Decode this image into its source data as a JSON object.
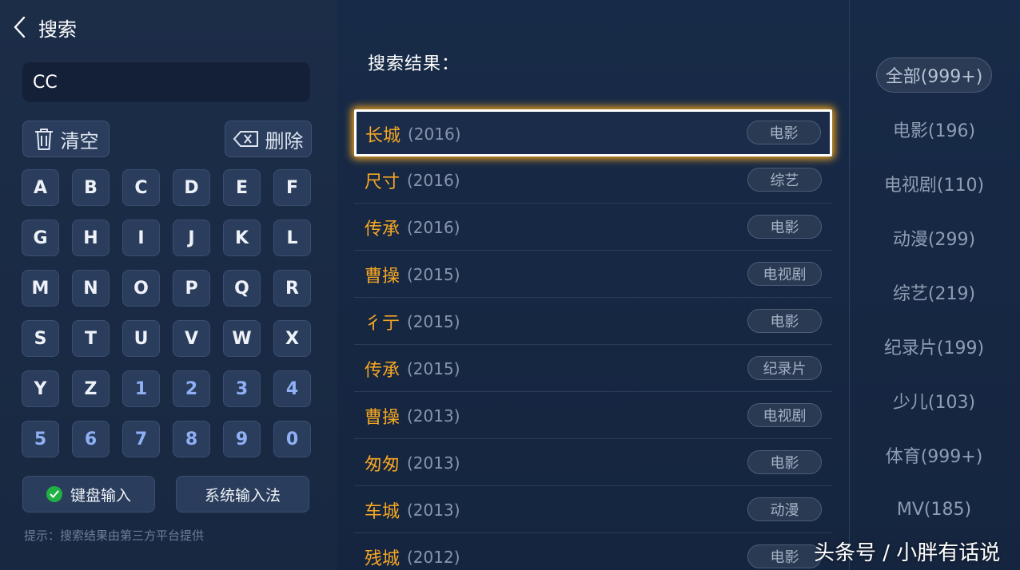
{
  "header": {
    "title": "搜索"
  },
  "search": {
    "query": "CC"
  },
  "keyboard": {
    "clear_label": "清空",
    "delete_label": "删除",
    "keys": [
      "A",
      "B",
      "C",
      "D",
      "E",
      "F",
      "G",
      "H",
      "I",
      "J",
      "K",
      "L",
      "M",
      "N",
      "O",
      "P",
      "Q",
      "R",
      "S",
      "T",
      "U",
      "V",
      "W",
      "X",
      "Y",
      "Z",
      "1",
      "2",
      "3",
      "4",
      "5",
      "6",
      "7",
      "8",
      "9",
      "0"
    ],
    "keyboard_input_label": "键盘输入",
    "system_input_label": "系统输入法",
    "hint": "提示：搜索结果由第三方平台提供"
  },
  "results": {
    "title": "搜索结果：",
    "items": [
      {
        "title": "长城",
        "year": "(2016)",
        "tag": "电影"
      },
      {
        "title": "尺寸",
        "year": "(2016)",
        "tag": "综艺"
      },
      {
        "title": "传承",
        "year": "(2016)",
        "tag": "电影"
      },
      {
        "title": "曹操",
        "year": "(2015)",
        "tag": "电视剧"
      },
      {
        "title": "彳亍",
        "year": "(2015)",
        "tag": "电影"
      },
      {
        "title": "传承",
        "year": "(2015)",
        "tag": "纪录片"
      },
      {
        "title": "曹操",
        "year": "(2013)",
        "tag": "电视剧"
      },
      {
        "title": "匆匆",
        "year": "(2013)",
        "tag": "电影"
      },
      {
        "title": "车城",
        "year": "(2013)",
        "tag": "动漫"
      },
      {
        "title": "残城",
        "year": "(2012)",
        "tag": "电影"
      }
    ]
  },
  "categories": [
    {
      "label": "全部(999+)"
    },
    {
      "label": "电影(196)"
    },
    {
      "label": "电视剧(110)"
    },
    {
      "label": "动漫(299)"
    },
    {
      "label": "综艺(219)"
    },
    {
      "label": "纪录片(199)"
    },
    {
      "label": "少儿(103)"
    },
    {
      "label": "体育(999+)"
    },
    {
      "label": "MV(185)"
    }
  ],
  "watermark": "头条号 / 小胖有话说",
  "colors": {
    "accent": "#f5a623",
    "focus_glow": "#f3a51e",
    "background": "#14233b",
    "check": "#1fb143"
  }
}
